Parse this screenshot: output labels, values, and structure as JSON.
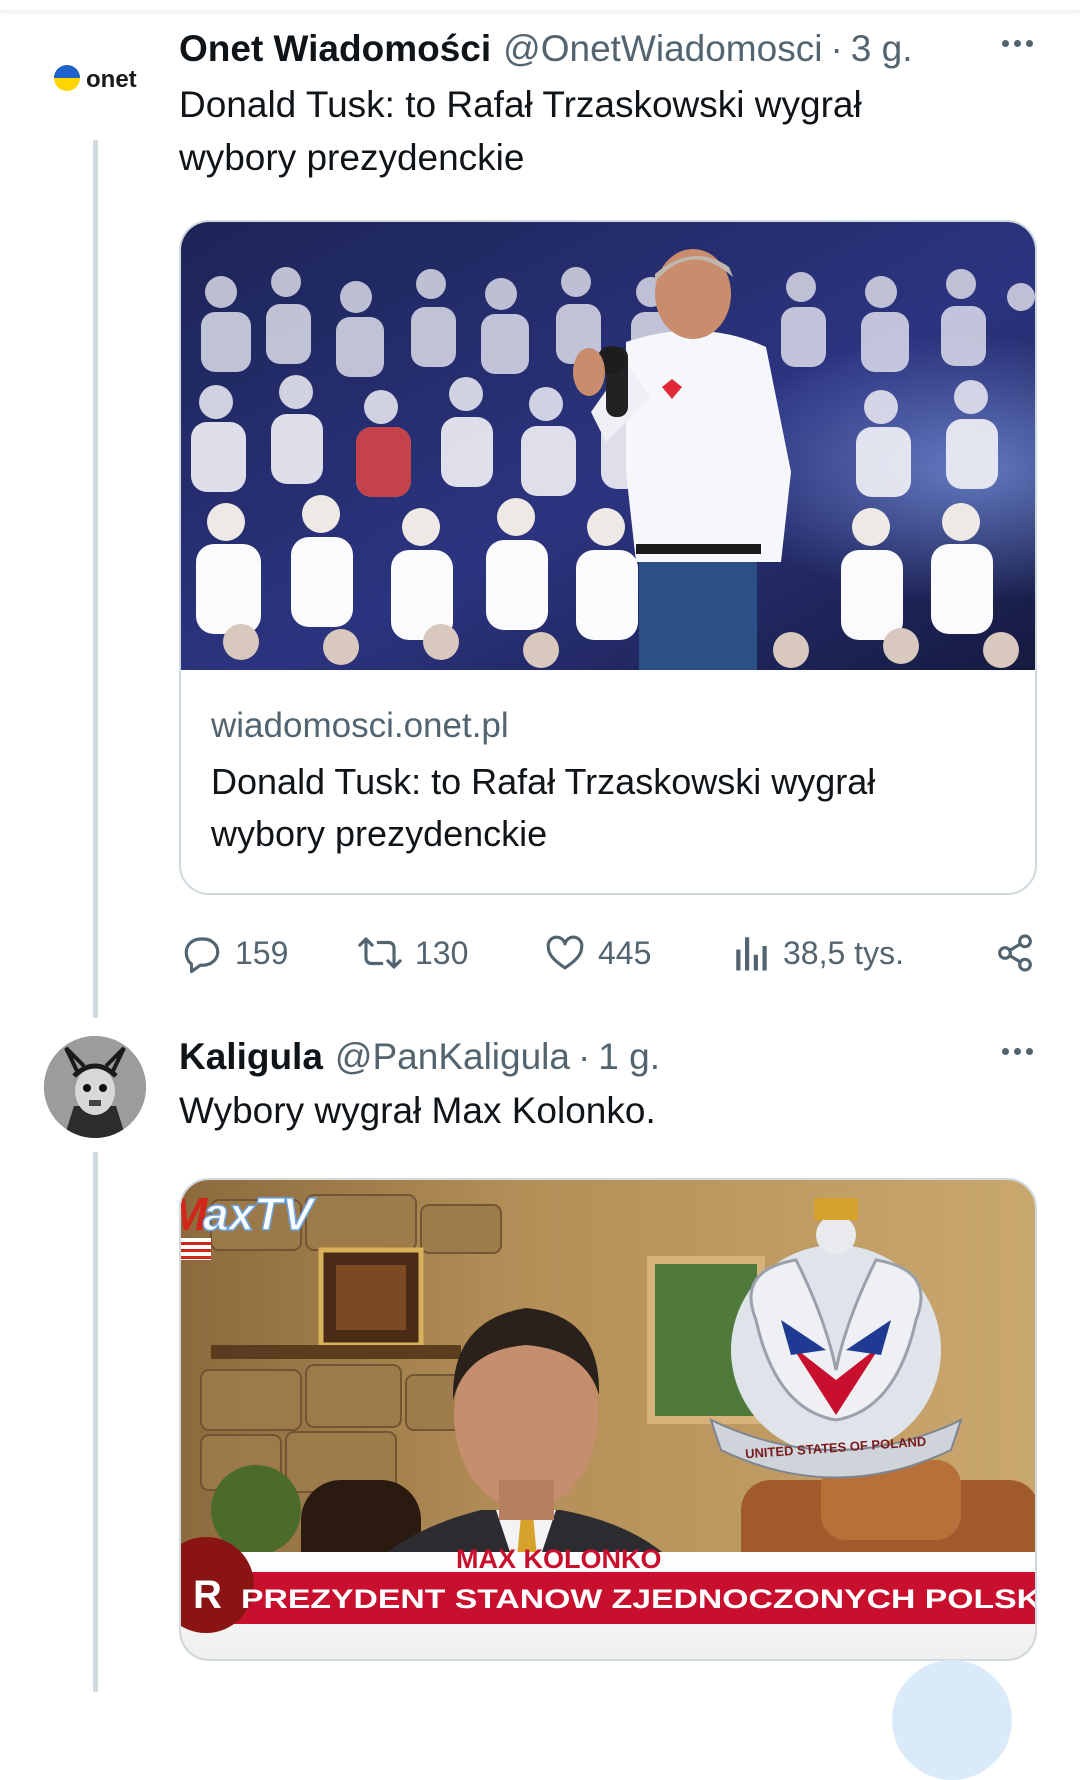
{
  "tweets": [
    {
      "author_name": "Onet Wiadomości",
      "handle": "@OnetWiadomosci",
      "separator": "·",
      "time": "3 g.",
      "avatar_text": "onet",
      "text_lines": [
        "Donald Tusk: to Rafał Trzaskowski wygrał",
        "wybory prezydenckie"
      ],
      "card": {
        "domain": "wiadomosci.onet.pl",
        "title_lines": [
          "Donald Tusk: to Rafał Trzaskowski wygrał",
          "wybory prezydenckie"
        ]
      },
      "actions": {
        "replies": "159",
        "reposts": "130",
        "likes": "445",
        "views": "38,5 tys."
      }
    },
    {
      "author_name": "Kaligula",
      "handle": "@PanKaligula",
      "separator": "·",
      "time": "1 g.",
      "text": "Wybory wygrał Max Kolonko.",
      "media": {
        "channel_logo": "axTV",
        "channel_logo_prefix": "M",
        "emblem_text": "UNITED STATES OF POLAND",
        "ticker_name": "MAX KOLONKO",
        "ticker_title": "PREZYDENT STANOW ZJEDNOCZONYCH POLSK",
        "ticker_badge": "R"
      }
    }
  ],
  "colors": {
    "text_primary": "#0f1419",
    "text_secondary": "#536471",
    "border": "#cfd9de",
    "ticker_red": "#c8102e"
  }
}
